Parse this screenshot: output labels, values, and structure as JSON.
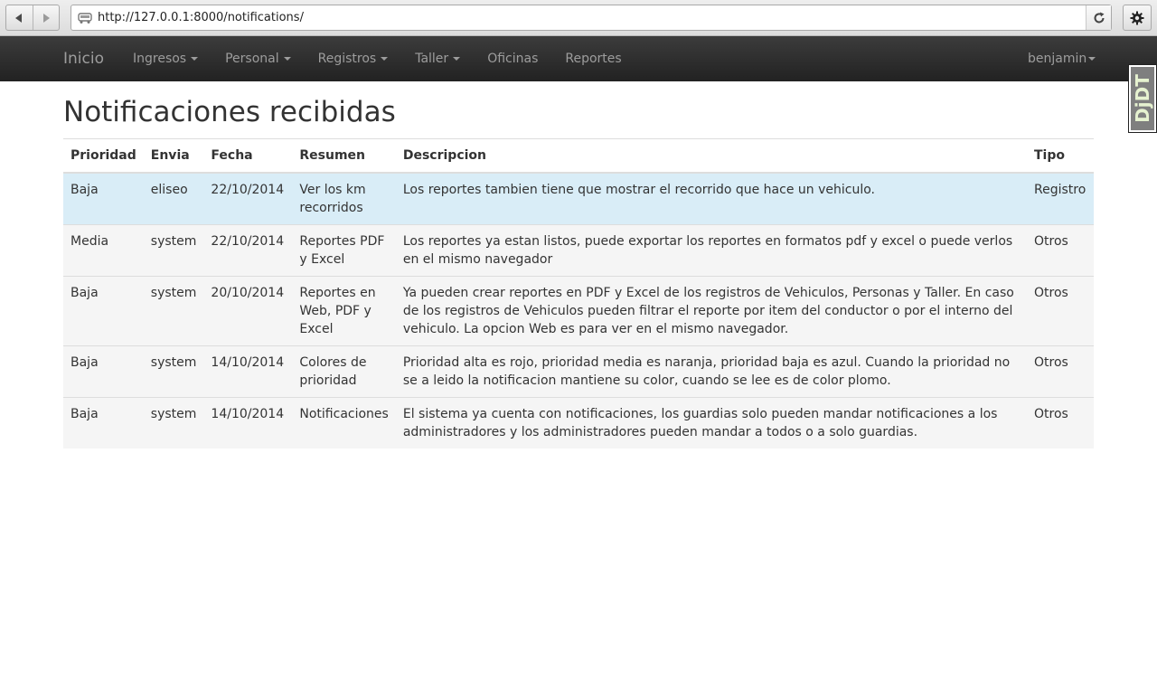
{
  "browser": {
    "url": "http://127.0.0.1:8000/notifications/"
  },
  "navbar": {
    "brand": "Inicio",
    "items": [
      {
        "label": "Ingresos",
        "dropdown": true
      },
      {
        "label": "Personal",
        "dropdown": true
      },
      {
        "label": "Registros",
        "dropdown": true
      },
      {
        "label": "Taller",
        "dropdown": true
      },
      {
        "label": "Oficinas",
        "dropdown": false
      },
      {
        "label": "Reportes",
        "dropdown": false
      }
    ],
    "user": "benjamin"
  },
  "djdt": {
    "label": "DjDT"
  },
  "page": {
    "title": "Notificaciones recibidas"
  },
  "table": {
    "headers": [
      "Prioridad",
      "Envia",
      "Fecha",
      "Resumen",
      "Descripcion",
      "Tipo"
    ],
    "rows": [
      {
        "prioridad": "Baja",
        "envia": "eliseo",
        "fecha": "22/10/2014",
        "resumen": "Ver los km recorridos",
        "descripcion": "Los reportes tambien tiene que mostrar el recorrido que hace un vehiculo.",
        "tipo": "Registro",
        "highlight": true
      },
      {
        "prioridad": "Media",
        "envia": "system",
        "fecha": "22/10/2014",
        "resumen": "Reportes PDF y Excel",
        "descripcion": "Los reportes ya estan listos, puede exportar los reportes en formatos pdf y excel o puede verlos en el mismo navegador",
        "tipo": "Otros",
        "highlight": false
      },
      {
        "prioridad": "Baja",
        "envia": "system",
        "fecha": "20/10/2014",
        "resumen": "Reportes en Web, PDF y Excel",
        "descripcion": "Ya pueden crear reportes en PDF y Excel de los registros de Vehiculos, Personas y Taller. En caso de los registros de Vehiculos pueden filtrar el reporte por item del conductor o por el interno del vehiculo. La opcion Web es para ver en el mismo navegador.",
        "tipo": "Otros",
        "highlight": false
      },
      {
        "prioridad": "Baja",
        "envia": "system",
        "fecha": "14/10/2014",
        "resumen": "Colores de prioridad",
        "descripcion": "Prioridad alta es rojo, prioridad media es naranja, prioridad baja es azul. Cuando la prioridad no se a leido la notificacion mantiene su color, cuando se lee es de color plomo.",
        "tipo": "Otros",
        "highlight": false
      },
      {
        "prioridad": "Baja",
        "envia": "system",
        "fecha": "14/10/2014",
        "resumen": "Notificaciones",
        "descripcion": "El sistema ya cuenta con notificaciones, los guardias solo pueden mandar notificaciones a los administradores y los administradores pueden mandar a todos o a solo guardias.",
        "tipo": "Otros",
        "highlight": false
      }
    ]
  },
  "colors": {
    "navbar_bg": "#222222",
    "nav_text": "#9d9d9d",
    "row_info": "#d9edf7",
    "row_default": "#f5f5f5"
  }
}
